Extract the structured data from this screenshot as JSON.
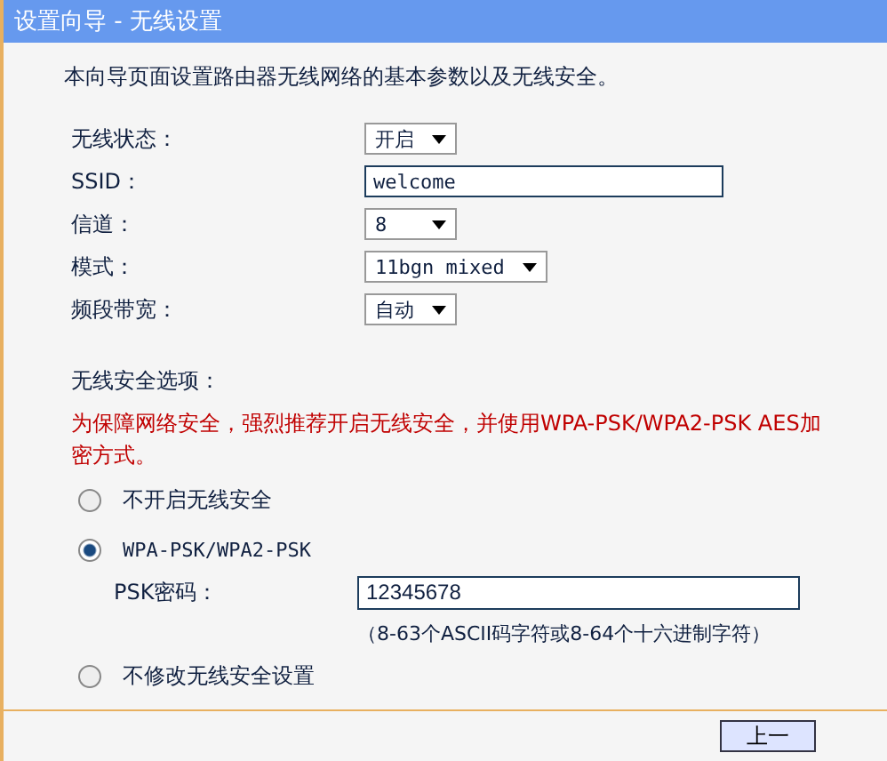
{
  "window": {
    "title": "设置向导 - 无线设置"
  },
  "intro": "本向导页面设置路由器无线网络的基本参数以及无线安全。",
  "fields": [
    {
      "label": "无线状态：",
      "kind": "select",
      "value": "开启"
    },
    {
      "label": "SSID：",
      "kind": "text",
      "value": "welcome"
    },
    {
      "label": "信道：",
      "kind": "select",
      "value": "8"
    },
    {
      "label": "模式：",
      "kind": "select",
      "value": "11bgn mixed"
    },
    {
      "label": "频段带宽：",
      "kind": "select",
      "value": "自动"
    }
  ],
  "security": {
    "title": "无线安全选项：",
    "warning": "为保障网络安全，强烈推荐开启无线安全，并使用WPA-PSK/WPA2-PSK AES加密方式。",
    "options": [
      {
        "label": "不开启无线安全",
        "selected": false
      },
      {
        "label": "WPA-PSK/WPA2-PSK",
        "selected": true,
        "psk": {
          "label": "PSK密码：",
          "value": "12345678",
          "hint": "（8-63个ASCII码字符或8-64个十六进制字符）"
        }
      },
      {
        "label": "不修改无线安全设置",
        "selected": false
      }
    ]
  },
  "buttons": [
    "上一"
  ]
}
